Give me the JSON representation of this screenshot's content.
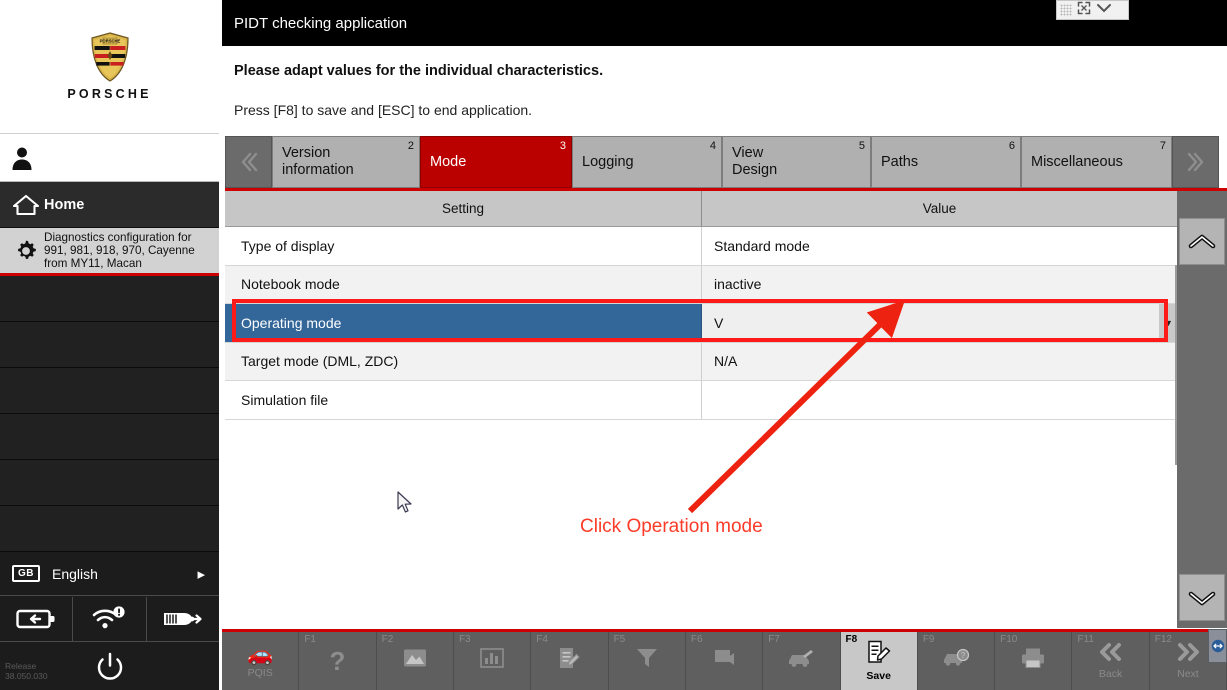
{
  "sidebar": {
    "brand": "PORSCHE",
    "crest_icon": "porsche-crest-icon",
    "user_icon": "user-icon",
    "nav": [
      {
        "label": "Home",
        "icon": "home-icon"
      },
      {
        "label": "Diagnostics configuration for 991, 981, 918, 970, Cayenne from MY11, Macan",
        "icon": "gear-icon"
      }
    ],
    "blank_row_count": 6,
    "language": {
      "badge": "GB",
      "label": "English",
      "arrow_icon": "chevron-right-icon"
    },
    "status_icons": [
      {
        "name": "battery-icon"
      },
      {
        "name": "wifi-warning-icon"
      },
      {
        "name": "vci-usb-icon"
      }
    ],
    "power_icon": "power-icon",
    "release_line1": "Release",
    "release_line2": "38.050.030"
  },
  "titlebar": {
    "title": "PIDT checking application",
    "close_icon": "close-icon",
    "float_widget": {
      "grip_icon": "grip-dots-icon",
      "expand_icon": "expand-arrows-icon",
      "collapse_icon": "chevron-down-icon"
    }
  },
  "header": {
    "main": "Please adapt values for the individual characteristics.",
    "sub": "Press [F8] to save and [ESC] to end application."
  },
  "tabs": {
    "prev_icon": "chevron-left-double-icon",
    "next_icon": "chevron-right-double-icon",
    "items": [
      {
        "label": "Version\ninformation",
        "num": "2",
        "active": false
      },
      {
        "label": "Mode",
        "num": "3",
        "active": true
      },
      {
        "label": "Logging",
        "num": "4",
        "active": false
      },
      {
        "label": "View\nDesign",
        "num": "5",
        "active": false
      },
      {
        "label": "Paths",
        "num": "6",
        "active": false
      },
      {
        "label": "Miscellaneous",
        "num": "7",
        "active": false
      }
    ]
  },
  "table": {
    "columns": [
      "Setting",
      "Value"
    ],
    "rows": [
      {
        "setting": "Type of display",
        "value": "Standard mode",
        "style": "white",
        "selected": false
      },
      {
        "setting": "Notebook mode",
        "value": "inactive",
        "style": "grey",
        "selected": false
      },
      {
        "setting": "Operating mode",
        "value": "V",
        "style": "grey",
        "selected": true,
        "dropdown_icon": "caret-down-icon"
      },
      {
        "setting": "Target mode (DML, ZDC)",
        "value": "N/A",
        "style": "grey",
        "selected": false
      },
      {
        "setting": "Simulation file",
        "value": "",
        "style": "white",
        "selected": false
      }
    ],
    "scroll_up_icon": "chevron-up-icon",
    "scroll_down_icon": "chevron-down-icon"
  },
  "function_keys": [
    {
      "num": "",
      "label": "PQIS",
      "icon": "pqis-car-icon",
      "enabled": false
    },
    {
      "num": "F1",
      "label": "",
      "icon": "help-question-icon",
      "enabled": false
    },
    {
      "num": "F2",
      "label": "",
      "icon": "image-icon",
      "enabled": false
    },
    {
      "num": "F3",
      "label": "",
      "icon": "bar-chart-icon",
      "enabled": false
    },
    {
      "num": "F4",
      "label": "",
      "icon": "edit-list-icon",
      "enabled": false
    },
    {
      "num": "F5",
      "label": "",
      "icon": "filter-funnel-icon",
      "enabled": false
    },
    {
      "num": "F6",
      "label": "",
      "icon": "screen-icon",
      "enabled": false
    },
    {
      "num": "F7",
      "label": "",
      "icon": "car-tool-icon",
      "enabled": false
    },
    {
      "num": "F8",
      "label": "Save",
      "icon": "save-edit-icon",
      "enabled": true
    },
    {
      "num": "F9",
      "label": "",
      "icon": "car-question-icon",
      "enabled": false
    },
    {
      "num": "F10",
      "label": "",
      "icon": "printer-icon",
      "enabled": false
    },
    {
      "num": "F11",
      "label": "Back",
      "icon": "chevron-left-double-icon",
      "enabled": false
    },
    {
      "num": "F12",
      "label": "Next",
      "icon": "chevron-right-double-icon",
      "enabled": false
    }
  ],
  "annotations": {
    "callout_text": "Click Operation mode",
    "highlight_color": "#ff1a1a",
    "arrow_color": "#ee2211"
  },
  "cursor": {
    "icon": "mouse-pointer-icon"
  }
}
